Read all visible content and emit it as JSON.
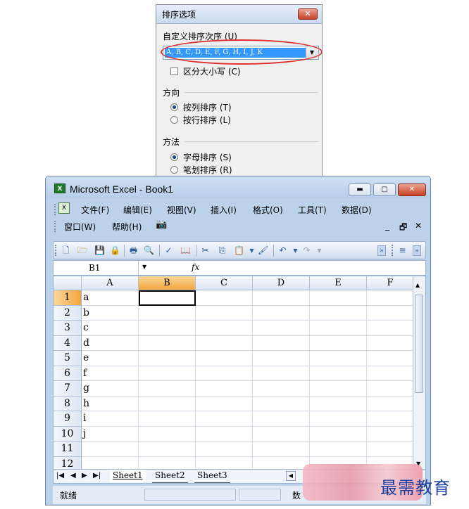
{
  "sort_dialog": {
    "title": "排序选项",
    "close_glyph": "✕",
    "custom_order_label": "自定义排序次序 (U)",
    "custom_order_value": "A, B, C, D, E, F, G, H, I, J, K",
    "case_sensitive_label": "区分大小写 (C)",
    "direction_label": "方向",
    "direction_options": [
      "按列排序 (T)",
      "按行排序 (L)"
    ],
    "method_label": "方法",
    "method_options": [
      "字母排序 (S)",
      "笔划排序 (R)"
    ]
  },
  "excel": {
    "title": "Microsoft Excel - Book1",
    "menu": [
      "文件(F)",
      "编辑(E)",
      "视图(V)",
      "插入(I)",
      "格式(O)",
      "工具(T)",
      "数据(D)",
      "窗口(W)",
      "帮助(H)"
    ],
    "doc_controls": [
      "_",
      "🗗",
      "✕"
    ],
    "name_box": "B1",
    "fx": "fx",
    "columns": [
      "A",
      "B",
      "C",
      "D",
      "E",
      "F"
    ],
    "rows": [
      "1",
      "2",
      "3",
      "4",
      "5",
      "6",
      "7",
      "8",
      "9",
      "10",
      "11",
      "12"
    ],
    "col_a_values": [
      "a",
      "b",
      "c",
      "d",
      "e",
      "f",
      "g",
      "h",
      "i",
      "j",
      "",
      ""
    ],
    "sheet_tabs": [
      "Sheet1",
      "Sheet2",
      "Sheet3"
    ],
    "status": "就绪",
    "status_right": "数"
  },
  "watermark": "最需教育"
}
